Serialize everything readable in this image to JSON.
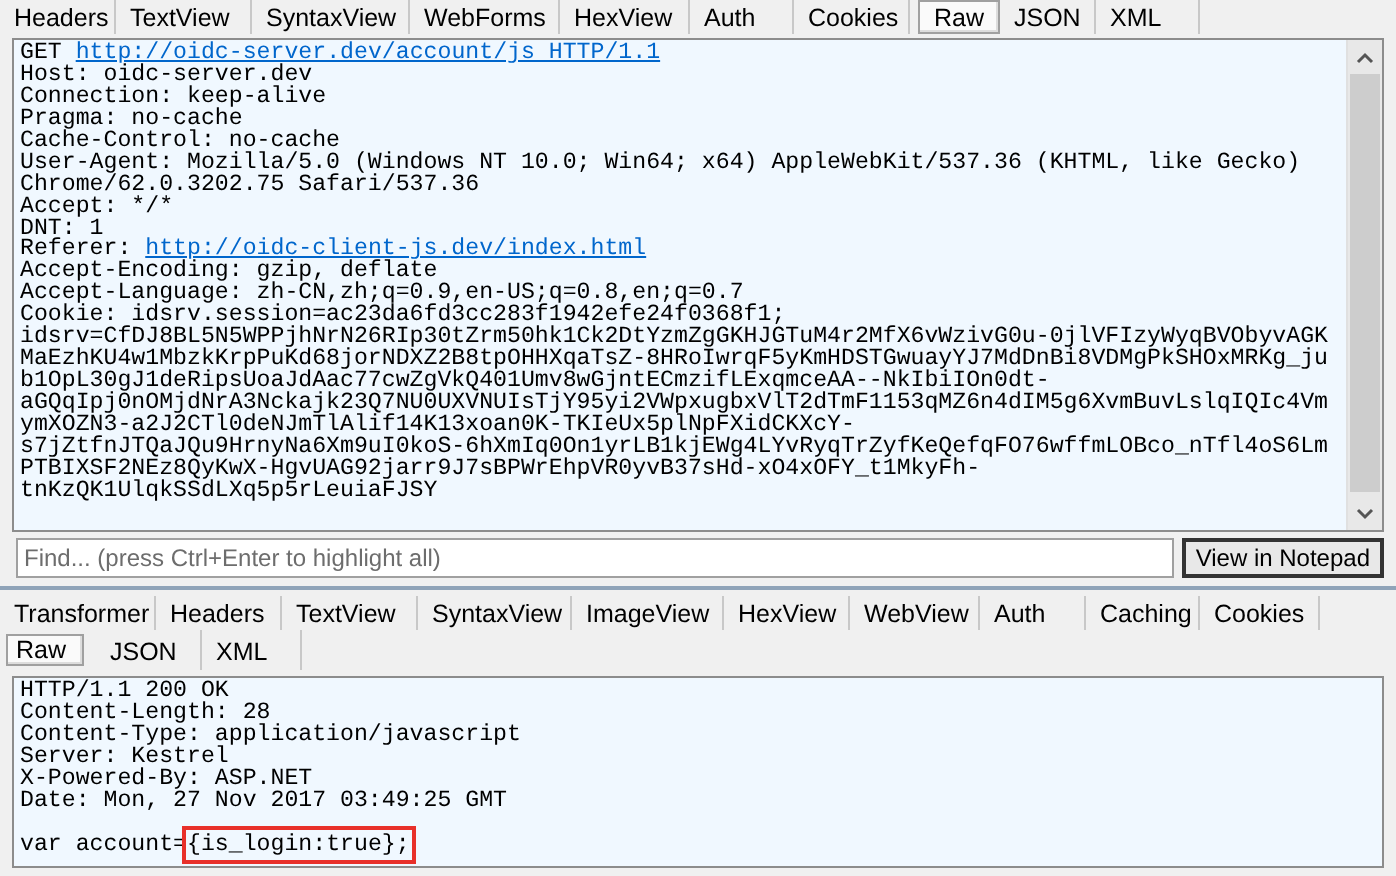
{
  "request_tabs": [
    {
      "label": "Headers",
      "selected": false
    },
    {
      "label": "TextView",
      "selected": false
    },
    {
      "label": "SyntaxView",
      "selected": false
    },
    {
      "label": "WebForms",
      "selected": false
    },
    {
      "label": "HexView",
      "selected": false
    },
    {
      "label": "Auth",
      "selected": false
    },
    {
      "label": "Cookies",
      "selected": false
    },
    {
      "label": "Raw",
      "selected": true
    },
    {
      "label": "JSON",
      "selected": false
    },
    {
      "label": "XML",
      "selected": false
    }
  ],
  "request_lines": [
    {
      "text": "GET ",
      "link": "http://oidc-server.dev/account/js HTTP/1.1"
    },
    {
      "text": "Host: oidc-server.dev"
    },
    {
      "text": "Connection: keep-alive"
    },
    {
      "text": "Pragma: no-cache"
    },
    {
      "text": "Cache-Control: no-cache"
    },
    {
      "text": "User-Agent: Mozilla/5.0 (Windows NT 10.0; Win64; x64) AppleWebKit/537.36 (KHTML, like Gecko)"
    },
    {
      "text": "Chrome/62.0.3202.75 Safari/537.36"
    },
    {
      "text": "Accept: */*"
    },
    {
      "text": "DNT: 1"
    },
    {
      "text": "Referer: ",
      "link": "http://oidc-client-js.dev/index.html"
    },
    {
      "text": "Accept-Encoding: gzip, deflate"
    },
    {
      "text": "Accept-Language: zh-CN,zh;q=0.9,en-US;q=0.8,en;q=0.7"
    },
    {
      "text": "Cookie: idsrv.session=ac23da6fd3cc283f1942efe24f0368f1;"
    },
    {
      "text": "idsrv=CfDJ8BL5N5WPPjhNrN26RIp30tZrm50hk1Ck2DtYzmZgGKHJGTuM4r2MfX6vWzivG0u-0jlVFIzyWyqBVObyvAGK"
    },
    {
      "text": "MaEzhKU4w1MbzkKrpPuKd68jorNDXZ2B8tpOHHXqaTsZ-8HRoIwrqF5yKmHDSTGwuayYJ7MdDnBi8VDMgPkSHOxMRKg_ju"
    },
    {
      "text": "b1OpL30gJ1deRipsUoaJdAac77cwZgVkQ401Umv8wGjntECmzifLExqmceAA--NkIbiIOn0dt-"
    },
    {
      "text": "aGQqIpj0nOMjdNrA3Nckajk23Q7NU0UXVNUIsTjY95yi2VWpxugbxVlT2dTmF1153qMZ6n4dIM5g6XvmBuvLslqIQIc4Vm"
    },
    {
      "text": "ymXOZN3-a2J2CTl0deNJmTlAlif14K13xoan0K-TKIeUx5plNpFXidCKXcY-"
    },
    {
      "text": "s7jZtfnJTQaJQu9HrnyNa6Xm9uI0koS-6hXmIq0On1yrLB1kjEWg4LYvRyqTrZyfKeQefqFO76wffmLOBco_nTfl4oS6Lm"
    },
    {
      "text": "PTBIXSF2NEz8QyKwX-HgvUAG92jarr9J7sBPWrEhpVR0yvB37sHd-xO4xOFY_t1MkyFh-"
    },
    {
      "text": "tnKzQK1UlqkSSdLXq5p5rLeuiaFJSY"
    }
  ],
  "find_bar": {
    "placeholder": "Find... (press Ctrl+Enter to highlight all)",
    "button": "View in Notepad"
  },
  "response_tabs": [
    {
      "label": "Transformer",
      "selected": false
    },
    {
      "label": "Headers",
      "selected": false
    },
    {
      "label": "TextView",
      "selected": false
    },
    {
      "label": "SyntaxView",
      "selected": false
    },
    {
      "label": "ImageView",
      "selected": false
    },
    {
      "label": "HexView",
      "selected": false
    },
    {
      "label": "WebView",
      "selected": false
    },
    {
      "label": "Auth",
      "selected": false
    },
    {
      "label": "Caching",
      "selected": false
    },
    {
      "label": "Cookies",
      "selected": false
    }
  ],
  "response_subtabs": [
    {
      "label": "Raw",
      "selected": true
    },
    {
      "label": "JSON",
      "selected": false
    },
    {
      "label": "XML",
      "selected": false
    }
  ],
  "response_lines": [
    {
      "text": "HTTP/1.1 200 OK"
    },
    {
      "text": "Content-Length: 28"
    },
    {
      "text": "Content-Type: application/javascript"
    },
    {
      "text": "Server: Kestrel"
    },
    {
      "text": "X-Powered-By: ASP.NET"
    },
    {
      "text": "Date: Mon, 27 Nov 2017 03:49:25 GMT",
      "blank_line_after": true
    },
    {
      "text": "var account=",
      "highlight": "{is_login:true};"
    }
  ]
}
